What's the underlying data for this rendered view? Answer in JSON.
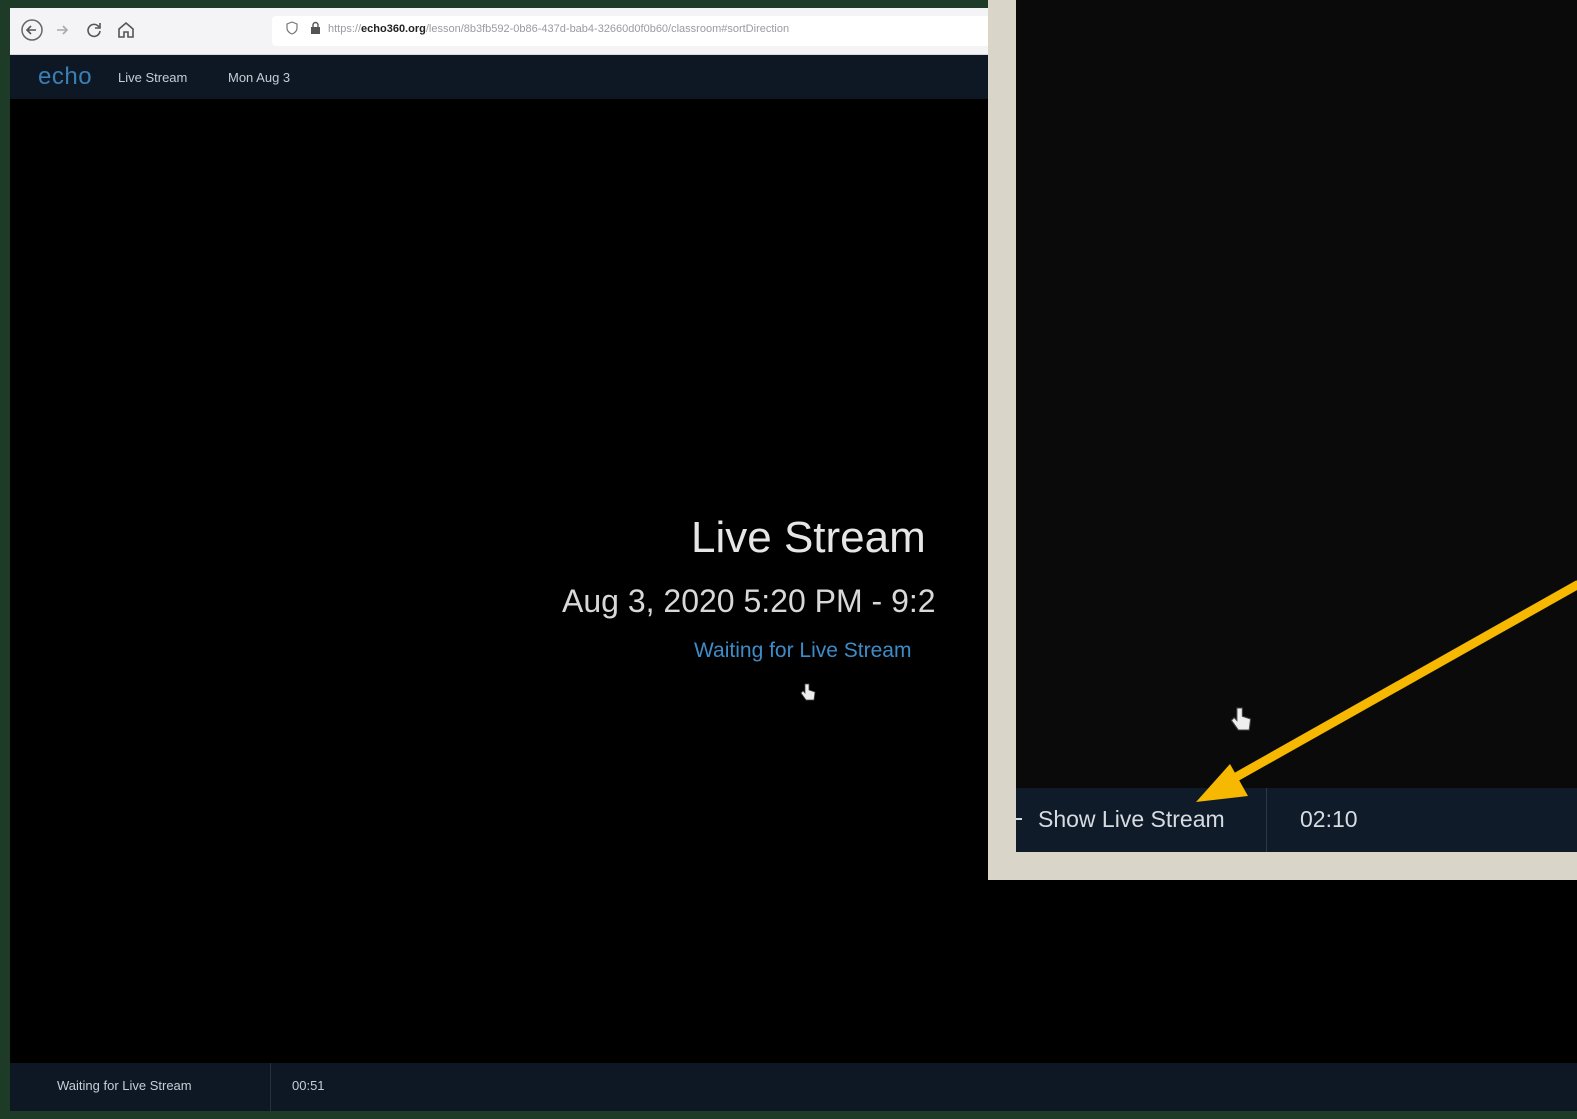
{
  "browser": {
    "url_prefix": "https://",
    "url_host": "echo360.org",
    "url_path": "/lesson/8b3fb592-0b86-437d-bab4-32660d0f0b60/classroom#sortDirection"
  },
  "app": {
    "logo": "echo",
    "breadcrumb_section": "Live Stream",
    "breadcrumb_date": "Mon Aug 3"
  },
  "main": {
    "title": "Live Stream",
    "time_range": "Aug 3, 2020 5:20 PM - 9:2",
    "status": "Waiting for Live Stream"
  },
  "bottom_bar": {
    "status": "Waiting for Live Stream",
    "timer": "00:51"
  },
  "inset": {
    "button_label": "Show Live Stream",
    "timer": "02:10"
  },
  "colors": {
    "accent": "#3d8cc8",
    "annotation_arrow": "#f6b800"
  }
}
